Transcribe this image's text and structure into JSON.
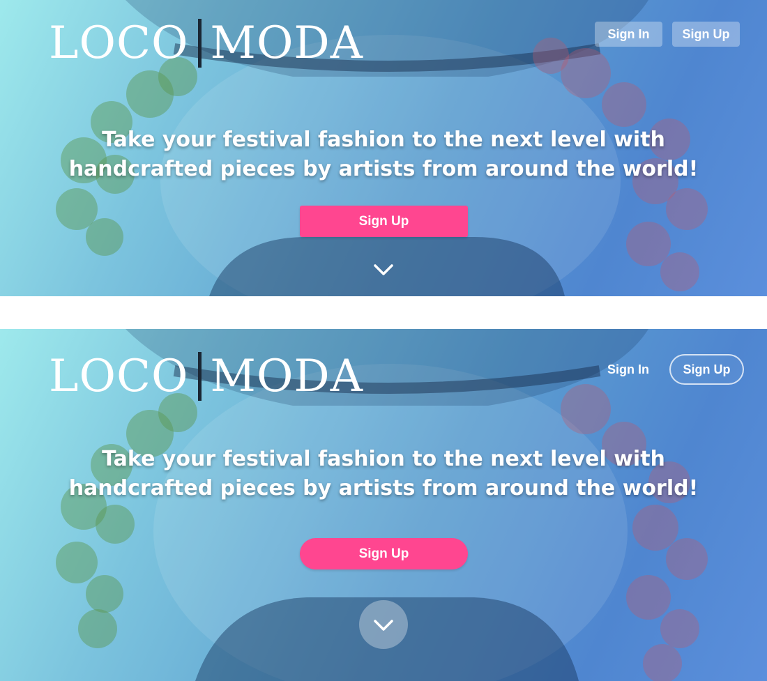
{
  "colors": {
    "gradient_start": "#9ee9ec",
    "gradient_end": "#5b8fdc",
    "cta_pink": "#ff4690",
    "logo_divider": "#1a2633",
    "text": "#ffffff"
  },
  "icons": {
    "scroll_down": "chevron-down-icon",
    "background": "flowered-figure-photo"
  },
  "variants": [
    {
      "logo": {
        "left": "LOCO",
        "right": "MODA"
      },
      "nav": {
        "sign_in": "Sign In",
        "sign_up": "Sign Up",
        "style": "filled rectangular buttons"
      },
      "headline": {
        "line1": "Take your festival fashion to the next level with",
        "line2": "handcrafted pieces by artists from around the world!"
      },
      "cta": {
        "label": "Sign Up",
        "style": "square"
      }
    },
    {
      "logo": {
        "left": "LOCO",
        "right": "MODA"
      },
      "nav": {
        "sign_in": "Sign In",
        "sign_up": "Sign Up",
        "style": "text link and outlined pill"
      },
      "headline": {
        "line1": "Take your festival fashion to the next level with",
        "line2": "handcrafted pieces by artists from around the world!"
      },
      "cta": {
        "label": "Sign Up",
        "style": "pill"
      }
    }
  ]
}
